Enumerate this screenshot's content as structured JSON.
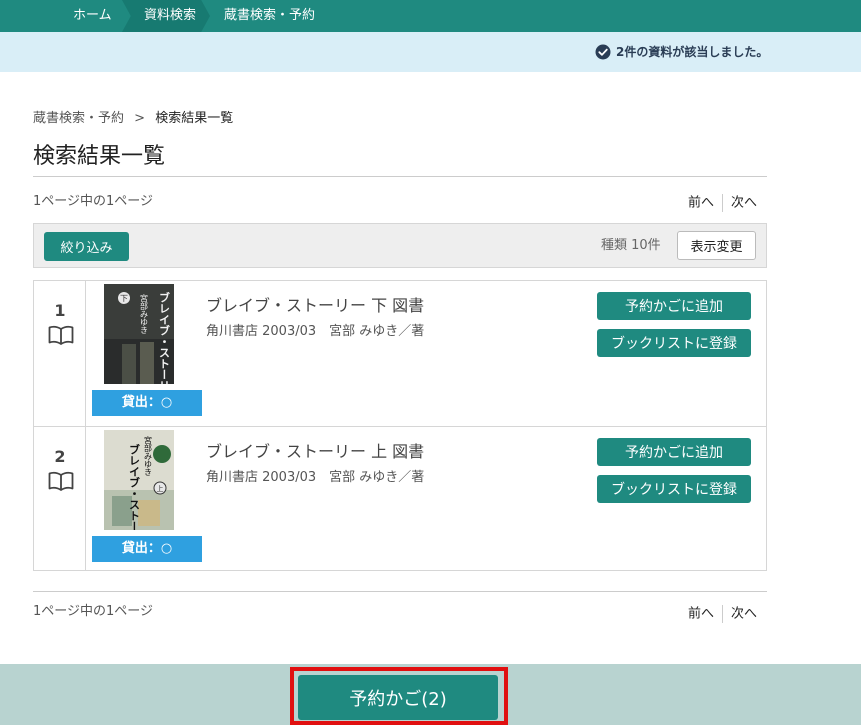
{
  "topbar": {
    "home": "ホーム",
    "search": "資料検索",
    "current": "蔵書検索・予約"
  },
  "notice": {
    "icon": "check-circle-icon",
    "text": "2件の資料が該当しました。"
  },
  "breadcrumb": {
    "parent": "蔵書検索・予約",
    "separator": ">",
    "current": "検索結果一覧"
  },
  "page_title": "検索結果一覧",
  "pagination": {
    "info": "1ページ中の1ページ",
    "prev": "前へ",
    "next": "次へ"
  },
  "filter": {
    "button": "絞り込み",
    "kind_label": "種類 10件",
    "view_button": "表示変更"
  },
  "results": [
    {
      "number": "1",
      "cover_text": "ブレイブ・ストーリー",
      "cover_author": "宮部みゆき",
      "cover_volume": "下",
      "availability": "貸出：○",
      "title": "ブレイブ・ストーリー 下 図書",
      "meta": "角川書店 2003/03　宮部 みゆき／著",
      "add_cart": "予約かごに追加",
      "add_booklist": "ブックリストに登録"
    },
    {
      "number": "2",
      "cover_text": "ブレイブ・ストーリー",
      "cover_author": "宮部みゆき",
      "cover_volume": "上",
      "availability": "貸出：○",
      "title": "ブレイブ・ストーリー 上 図書",
      "meta": "角川書店 2003/03　宮部 みゆき／著",
      "add_cart": "予約かごに追加",
      "add_booklist": "ブックリストに登録"
    }
  ],
  "cart_button": "予約かご(2)",
  "colors": {
    "brand": "#1f8a80",
    "notice_bg": "#d9eef7",
    "availability": "#2fa0e0",
    "highlight": "#e01010"
  }
}
